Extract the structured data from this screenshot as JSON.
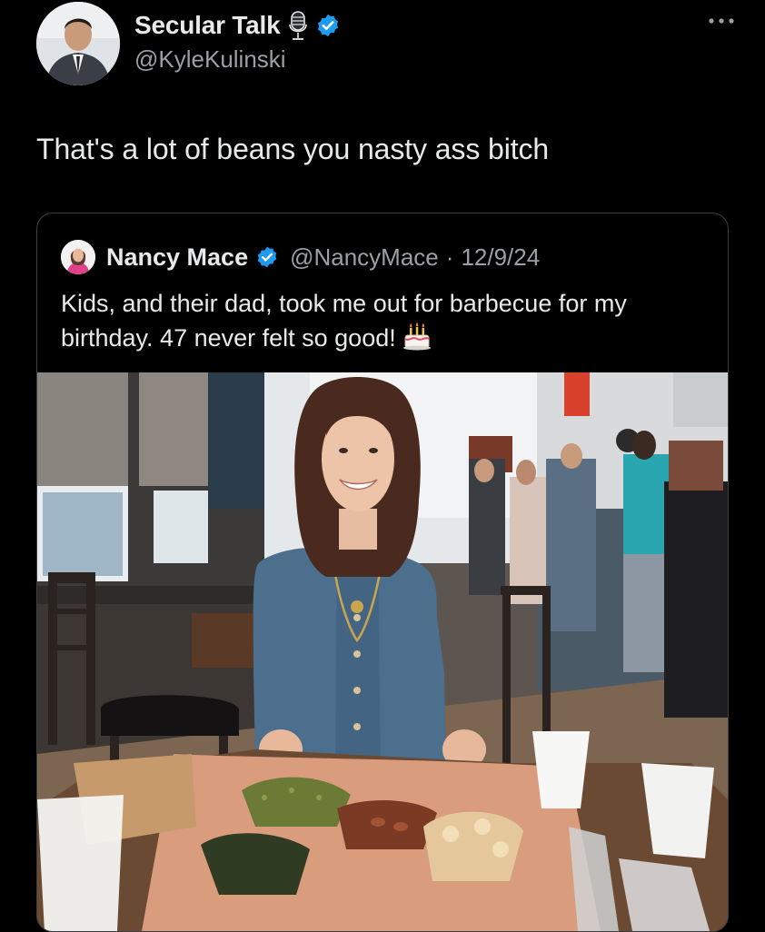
{
  "tweet": {
    "author": {
      "display_name": "Secular Talk",
      "handle": "@KyleKulinski",
      "verified": true,
      "badge_icon": "microphone-icon"
    },
    "text": "That's a lot of beans you nasty ass bitch",
    "more_icon": "more-options-icon"
  },
  "quoted_tweet": {
    "author": {
      "display_name": "Nancy Mace",
      "handle": "@NancyMace",
      "verified": true
    },
    "separator": "·",
    "date": "12/9/24",
    "text": "Kids, and their dad, took me out for barbecue for my birthday. 47 never felt so good!",
    "emoji_icon": "birthday-cake-icon"
  },
  "colors": {
    "background": "#000000",
    "text_primary": "#e7e9ea",
    "text_secondary": "#9aa0a6",
    "verified_blue": "#1d9bf0",
    "border": "#3a3f44"
  }
}
